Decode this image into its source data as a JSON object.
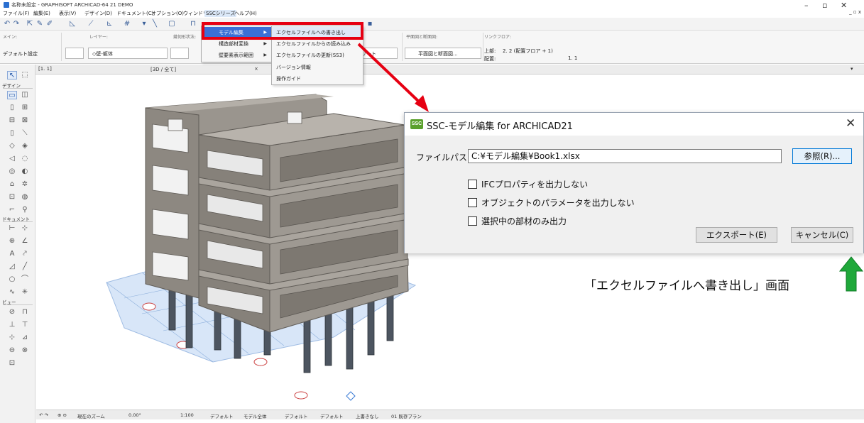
{
  "window": {
    "title": "名称未設定 - GRAPHISOFT ARCHICAD-64 21 DEMO",
    "minimize": "–",
    "maximize": "▫",
    "close": "✕",
    "doc_controls": "_ ▫ x"
  },
  "menubar": {
    "items": [
      "ファイル(F)",
      "編集(E)",
      "表示(V)",
      "デザイン(D)",
      "ドキュメント(C)",
      "オプション(O)",
      "ウィンドウ(W)",
      "SSCシリーズ",
      "ヘルプ(H)"
    ]
  },
  "infobox": {
    "main_label": "メイン:",
    "main_value": "デフォルト設定",
    "layer_label": "レイヤー:",
    "layer_value": "◇壁-躯体",
    "geometry_label": "幾何形状法:",
    "composite_value": "リート",
    "floorplan_label": "平面図と断面図:",
    "floorplan_value": "平面図と断面図...",
    "link_label": "リンクフロア:",
    "top_label": "上部:",
    "top_value": "2. 2 (配置フロア + 1)",
    "story_label": "配置:",
    "story_value": "1. 1"
  },
  "ssc_menu": {
    "items": [
      {
        "label": "モデル編集",
        "has_sub": true
      },
      {
        "label": "構造部材変換",
        "has_sub": true
      },
      {
        "label": "壁要素表示範囲",
        "has_sub": true
      }
    ]
  },
  "model_submenu": {
    "items": [
      "エクセルファイルへの書き出し",
      "エクセルファイルからの読み込み",
      "エクセルファイルの更新(SS3)",
      "バージョン情報",
      "操作ガイド"
    ]
  },
  "tabs": {
    "floor": "[1. 1]",
    "view3d": "[3D / 全て]"
  },
  "toolbox": {
    "design": "デザイン",
    "document": "ドキュメント",
    "view": "ビュー"
  },
  "dialog": {
    "icon_text": "SSC",
    "title": "SSC-モデル編集 for ARCHICAD21",
    "close": "✕",
    "path_label": "ファイルパス",
    "path_value": "C:¥モデル編集¥Book1.xlsx",
    "browse": "参照(R)...",
    "checkboxes": [
      {
        "label": "IFCプロパティを出力しない",
        "checked": false
      },
      {
        "label": "オブジェクトのパラメータを出力しない",
        "checked": false
      },
      {
        "label": "選択中の部材のみ出力",
        "checked": false
      }
    ],
    "export": "エクスポート(E)",
    "cancel": "キャンセル(C)"
  },
  "caption": "「エクセルファイルへ書き出し」画面",
  "statusbar": {
    "zoom_label": "現在のズーム",
    "angle": "0.00°",
    "scale": "1:100",
    "pen_set": "デフォルト",
    "model_view": "モデル全体",
    "layer_combo": "デフォルト",
    "dim": "デフォルト",
    "override": "上書きなし",
    "renovation": "01 既存プラン"
  },
  "colors": {
    "highlight_red": "#e60012",
    "arrow_green": "#1fa83a",
    "menu_select": "#3b6fd6",
    "concrete": "#8f8a84"
  }
}
